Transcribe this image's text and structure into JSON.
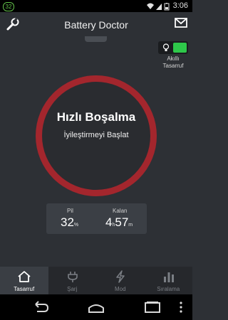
{
  "status_bar": {
    "badge": "32",
    "time": "3:06"
  },
  "header": {
    "title": "Battery Doctor",
    "settings_icon": "wrench-icon",
    "mail_icon": "mail-icon"
  },
  "smart_save": {
    "label_line1": "Akıllı",
    "label_line2": "Tasarruf",
    "enabled": true
  },
  "main_button": {
    "title": "Hızlı Boşalma",
    "subtitle": "İyileştirmeyi Başlat",
    "ring_color": "#a3262d"
  },
  "stats": {
    "battery_label": "Pil",
    "battery_value": "32",
    "battery_unit": "%",
    "remaining_label": "Kalan",
    "remaining_hours": "4",
    "hours_unit": "h",
    "remaining_minutes": "57",
    "minutes_unit": "m"
  },
  "tabs": [
    {
      "label": "Tasarruf",
      "icon": "home-icon",
      "active": true
    },
    {
      "label": "Şarj",
      "icon": "plug-icon",
      "active": false
    },
    {
      "label": "Mod",
      "icon": "lightning-icon",
      "active": false
    },
    {
      "label": "Sıralama",
      "icon": "bar-chart-icon",
      "active": false
    }
  ],
  "nav": {
    "back_icon": "back-icon",
    "home_icon": "home-nav-icon",
    "recents_icon": "recents-icon",
    "menu_icon": "menu-dots-icon"
  }
}
